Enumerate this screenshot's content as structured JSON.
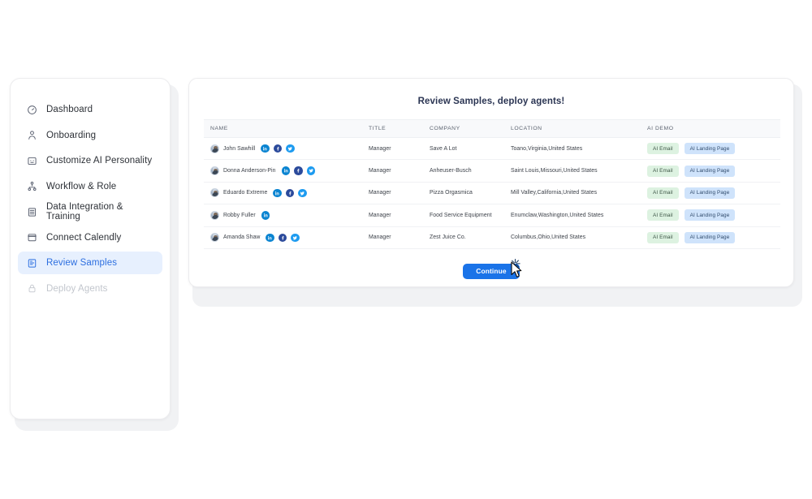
{
  "sidebar": {
    "items": [
      {
        "label": "Dashboard",
        "icon": "gauge-icon",
        "state": "default"
      },
      {
        "label": "Onboarding",
        "icon": "person-icon",
        "state": "default"
      },
      {
        "label": "Customize AI Personality",
        "icon": "robot-face-icon",
        "state": "default"
      },
      {
        "label": "Workflow & Role",
        "icon": "sitemap-icon",
        "state": "default"
      },
      {
        "label": "Data Integration & Training",
        "icon": "server-icon",
        "state": "default"
      },
      {
        "label": "Connect Calendly",
        "icon": "calendar-icon",
        "state": "default"
      },
      {
        "label": "Review Samples",
        "icon": "document-scan-icon",
        "state": "active"
      },
      {
        "label": "Deploy Agents",
        "icon": "lock-icon",
        "state": "disabled"
      }
    ]
  },
  "main": {
    "title": "Review Samples, deploy agents!",
    "table": {
      "columns": [
        "NAME",
        "TITLE",
        "COMPANY",
        "LOCATION",
        "AI DEMO"
      ],
      "rows": [
        {
          "name": "John Sawhill",
          "title": "Manager",
          "company": "Save A Lot",
          "location": "Toano,Virginia,United States",
          "socials": [
            "linkedin",
            "facebook",
            "twitter"
          ],
          "demo": {
            "email": "AI Email",
            "landing": "AI Landing Page"
          }
        },
        {
          "name": "Donna Anderson-Pin",
          "title": "Manager",
          "company": "Anheuser-Busch",
          "location": "Saint Louis,Missouri,United States",
          "socials": [
            "linkedin",
            "facebook",
            "twitter"
          ],
          "demo": {
            "email": "AI Email",
            "landing": "AI Landing Page"
          }
        },
        {
          "name": "Eduardo Extreme",
          "title": "Manager",
          "company": "Pizza Orgasmica",
          "location": "Mill Valley,California,United States",
          "socials": [
            "linkedin",
            "facebook",
            "twitter"
          ],
          "demo": {
            "email": "AI Email",
            "landing": "AI Landing Page"
          }
        },
        {
          "name": "Robby Fuller",
          "title": "Manager",
          "company": "Food Service Equipment",
          "location": "Enumclaw,Washington,United States",
          "socials": [
            "linkedin"
          ],
          "demo": {
            "email": "AI Email",
            "landing": "AI Landing Page"
          }
        },
        {
          "name": "Amanda Shaw",
          "title": "Manager",
          "company": "Zest Juice Co.",
          "location": "Columbus,Ohio,United States",
          "socials": [
            "linkedin",
            "facebook",
            "twitter"
          ],
          "demo": {
            "email": "AI Email",
            "landing": "AI Landing Page"
          }
        }
      ]
    },
    "continue_label": "Continue"
  },
  "colors": {
    "accent_blue": "#1a73e8",
    "active_nav_bg": "#e7f0fe",
    "active_nav_text": "#2d6fe0",
    "chip_email_bg": "#ddf2e1",
    "chip_landing_bg": "#cfe3fb",
    "page_bg": "#ffffff",
    "card_shadow_bg": "#f1f2f4"
  }
}
